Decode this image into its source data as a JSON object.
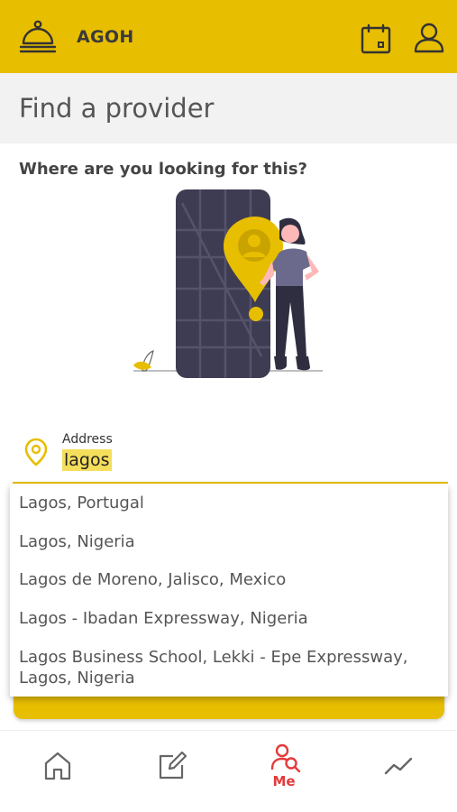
{
  "app": {
    "title": "AGOH",
    "colors": {
      "brand": "#e8be00",
      "active_nav": "#e23b3b",
      "illustration_dark": "#3e3c52",
      "accent_purple": "#6c6a8c"
    }
  },
  "header": {
    "icons": [
      "cloche-icon",
      "calendar-icon",
      "user-icon"
    ]
  },
  "page": {
    "title": "Find a provider",
    "question": "Where are you looking for this?"
  },
  "address": {
    "label": "Address",
    "value": "lagos",
    "icon": "location-pin-icon"
  },
  "suggestions": [
    {
      "text": "Lagos, Portugal"
    },
    {
      "text": "Lagos, Nigeria"
    },
    {
      "text": "Lagos de Moreno, Jalisco, Mexico"
    },
    {
      "text": "Lagos - Ibadan Expressway, Nigeria"
    },
    {
      "text": "Lagos Business School, Lekki - Epe Expressway,",
      "text2": "Lagos, Nigeria"
    }
  ],
  "bottom_nav": {
    "items": [
      {
        "name": "home",
        "icon": "home-icon",
        "label": ""
      },
      {
        "name": "edit",
        "icon": "edit-icon",
        "label": ""
      },
      {
        "name": "me",
        "icon": "search-person-icon",
        "label": "Me",
        "active": true
      },
      {
        "name": "stats",
        "icon": "trend-icon",
        "label": ""
      }
    ]
  }
}
